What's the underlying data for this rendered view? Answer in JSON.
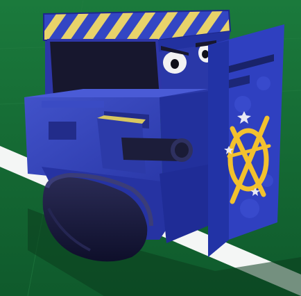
{
  "scene": {
    "ground_color": "#13652f",
    "ground_light": "#1a7a3a",
    "line_color": "#f4f6f5",
    "shadow_color": "#0b3d1e"
  },
  "robot": {
    "body_color": "#2f3fb8",
    "body_dark": "#1d278a",
    "body_light": "#4657d0",
    "stripe_yellow": "#e8d36a",
    "stripe_blue": "#3346c4",
    "track_color": "#15163a",
    "face_color": "#17172e",
    "shield_color": "#2f40c0",
    "emblem_color": "#f2c12e"
  },
  "icons": {
    "emblem": "crossed-target-emblem-icon",
    "eyes": "angry-eyes-icon"
  }
}
